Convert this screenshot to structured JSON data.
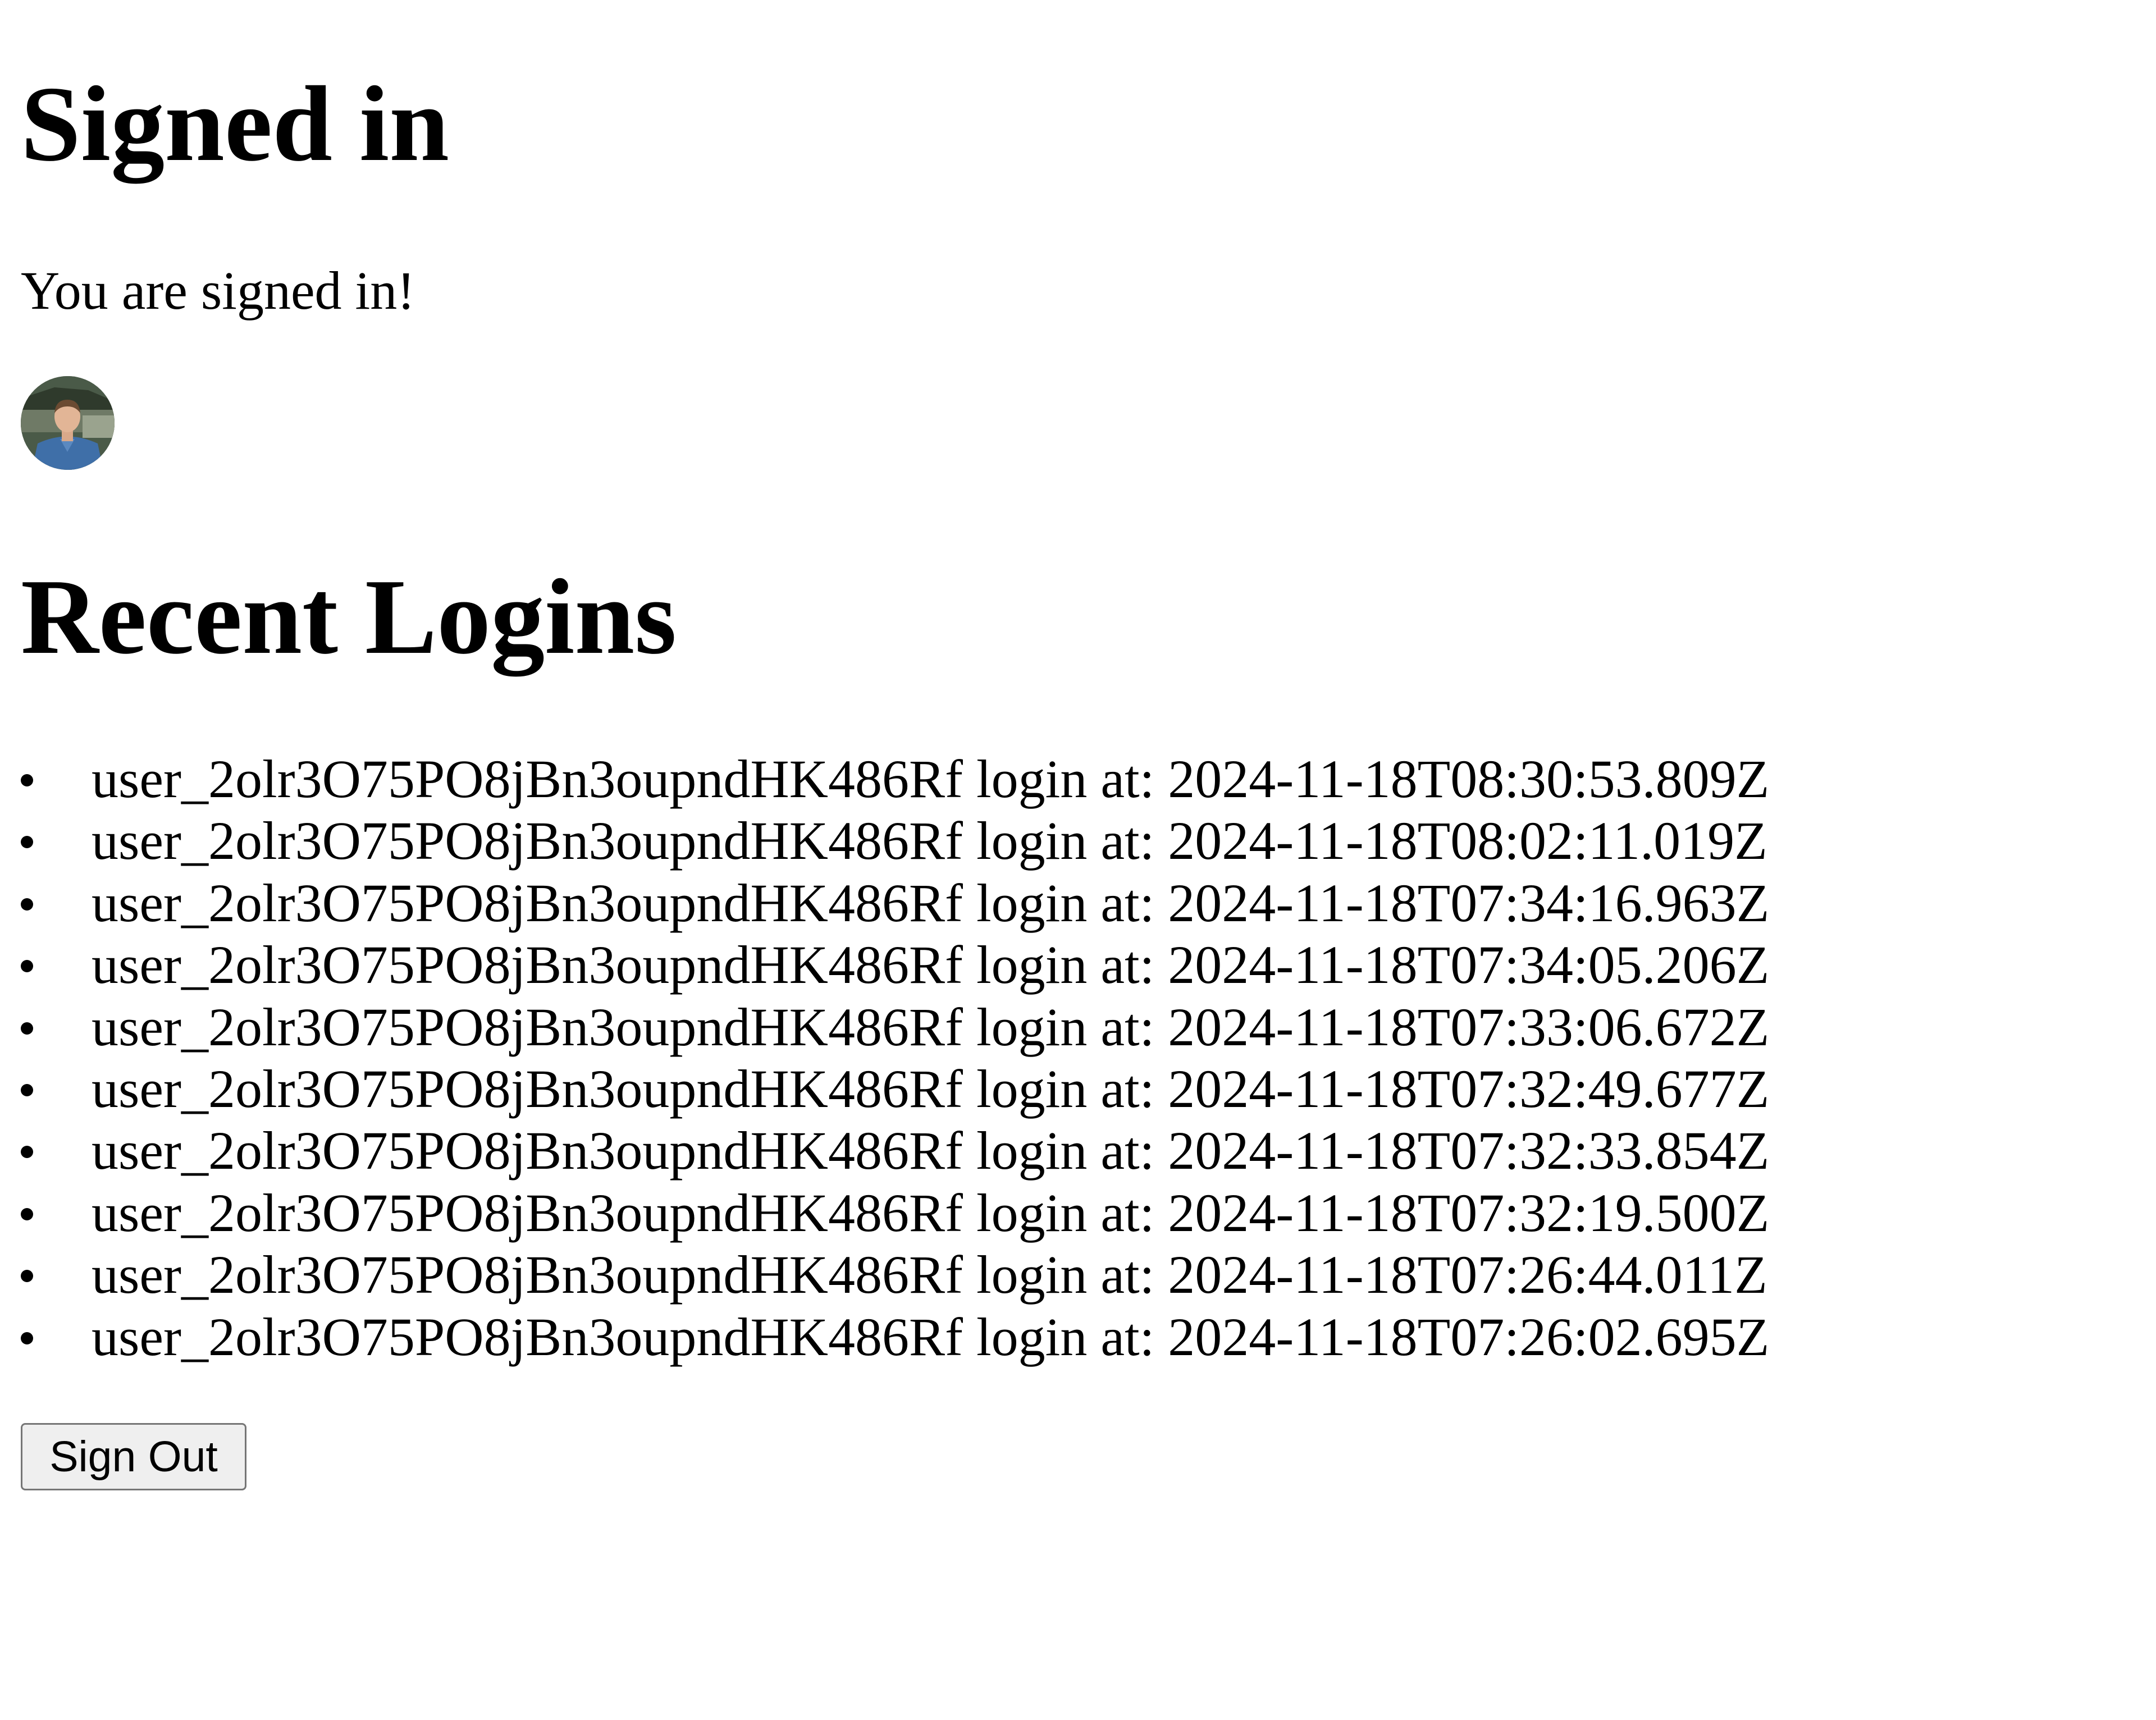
{
  "header": {
    "title": "Signed in",
    "message": "You are signed in!"
  },
  "avatar": {
    "icon": "user-avatar-photo"
  },
  "recent_logins": {
    "title": "Recent Logins",
    "items": [
      "user_2olr3O75PO8jBn3oupndHK486Rf login at: 2024-11-18T08:30:53.809Z",
      "user_2olr3O75PO8jBn3oupndHK486Rf login at: 2024-11-18T08:02:11.019Z",
      "user_2olr3O75PO8jBn3oupndHK486Rf login at: 2024-11-18T07:34:16.963Z",
      "user_2olr3O75PO8jBn3oupndHK486Rf login at: 2024-11-18T07:34:05.206Z",
      "user_2olr3O75PO8jBn3oupndHK486Rf login at: 2024-11-18T07:33:06.672Z",
      "user_2olr3O75PO8jBn3oupndHK486Rf login at: 2024-11-18T07:32:49.677Z",
      "user_2olr3O75PO8jBn3oupndHK486Rf login at: 2024-11-18T07:32:33.854Z",
      "user_2olr3O75PO8jBn3oupndHK486Rf login at: 2024-11-18T07:32:19.500Z",
      "user_2olr3O75PO8jBn3oupndHK486Rf login at: 2024-11-18T07:26:44.011Z",
      "user_2olr3O75PO8jBn3oupndHK486Rf login at: 2024-11-18T07:26:02.695Z"
    ]
  },
  "actions": {
    "sign_out_label": "Sign Out"
  }
}
